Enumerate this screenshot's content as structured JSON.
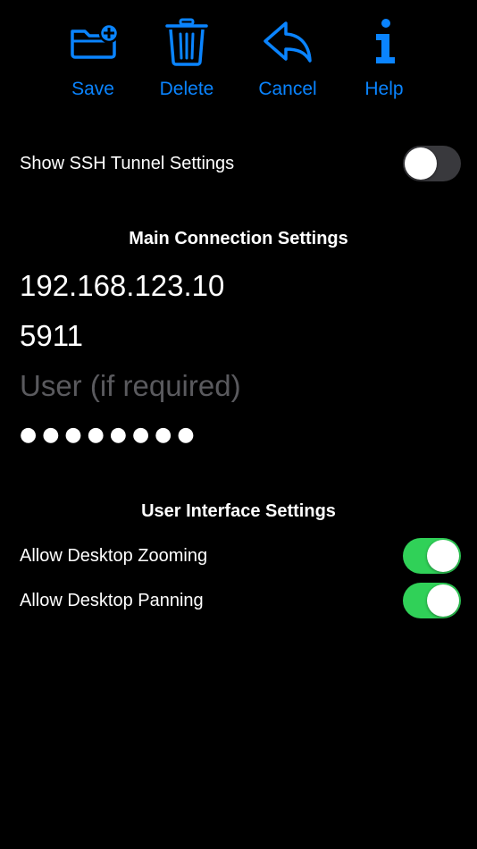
{
  "accent_color": "#0a84ff",
  "toggle_on_color": "#30d158",
  "toggle_off_color": "#39393d",
  "toolbar": {
    "save": {
      "label": "Save",
      "icon": "folder-plus-icon"
    },
    "delete": {
      "label": "Delete",
      "icon": "trash-icon"
    },
    "cancel": {
      "label": "Cancel",
      "icon": "undo-arrow-icon"
    },
    "help": {
      "label": "Help",
      "icon": "info-icon"
    }
  },
  "ssh_tunnel": {
    "label": "Show SSH Tunnel Settings",
    "enabled": false
  },
  "main_connection": {
    "title": "Main Connection Settings",
    "address": {
      "value": "192.168.123.10",
      "placeholder": ""
    },
    "port": {
      "value": "5911",
      "placeholder": ""
    },
    "user": {
      "value": "",
      "placeholder": "User (if required)"
    },
    "password": {
      "value": "●●●●●●●●",
      "placeholder": ""
    }
  },
  "user_interface": {
    "title": "User Interface Settings",
    "zooming": {
      "label": "Allow Desktop Zooming",
      "enabled": true
    },
    "panning": {
      "label": "Allow Desktop Panning",
      "enabled": true
    }
  }
}
